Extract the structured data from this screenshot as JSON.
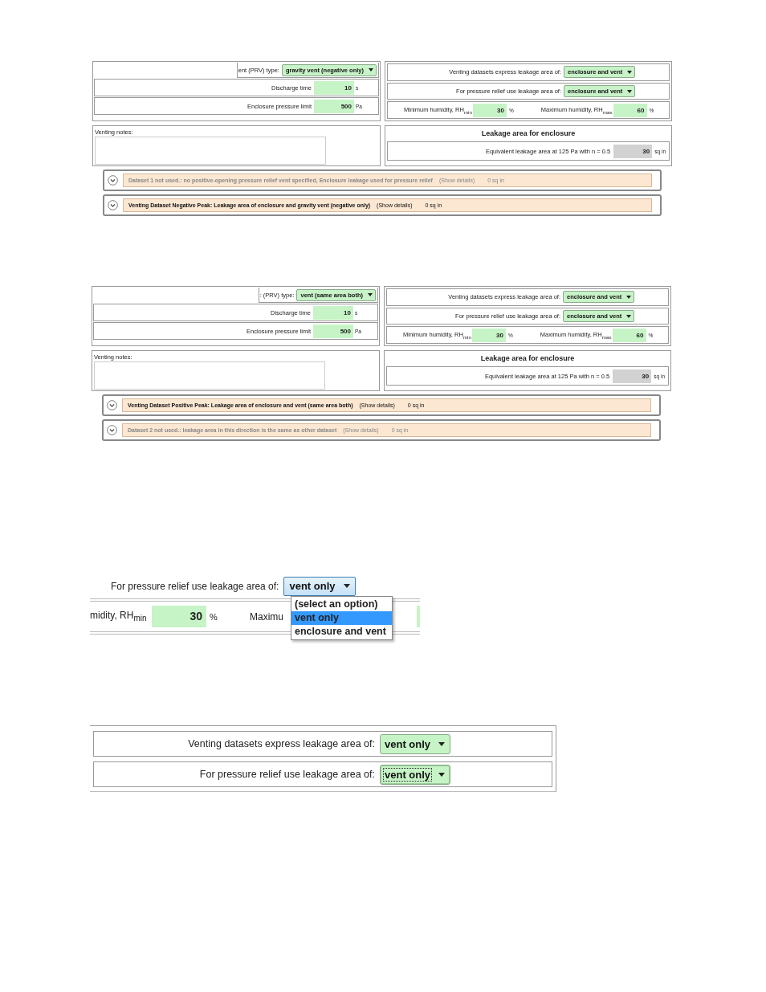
{
  "forms": [
    {
      "prv": {
        "label": "ent (PRV) type:",
        "value": "gravity vent (negative only)"
      },
      "discharge": {
        "label": "Discharge time",
        "value": "10",
        "unit": "s"
      },
      "pressure": {
        "label": "Enclosure pressure limit",
        "value": "500",
        "unit": "Pa"
      },
      "express": {
        "label": "Venting datasets express leakage area of:",
        "value": "enclosure and vent"
      },
      "relief": {
        "label": "For pressure relief use leakage area of:",
        "value": "enclosure and vent"
      },
      "hum_min": {
        "label": "Minimum humidity, RH$_{min}$",
        "value": "30",
        "unit": "%"
      },
      "hum_max": {
        "label": "Maximum humidity, RH$_{max}$",
        "value": "60",
        "unit": "%"
      },
      "notes_label": "Venting notes:",
      "leakage_title": "Leakage area for enclosure",
      "leakage": {
        "label": "Equivalent leakage area at 125 Pa with n = 0.5",
        "value": "30",
        "unit": "sq in"
      },
      "datasets": [
        {
          "title": "Dataset 1 not used.: no positive-opening pressure relief vent specified, Enclosure leakage used for pressure relief",
          "used": false,
          "details": "(Show details)",
          "area": "0 sq in"
        },
        {
          "title": "Venting Dataset Negative Peak: Leakage area of enclosure and gravity vent (negative only)",
          "used": true,
          "details": "(Show details)",
          "area": "0 sq in"
        }
      ]
    },
    {
      "prv": {
        "label": ": (PRV) type:",
        "value": "vent (same area both)"
      },
      "discharge": {
        "label": "Discharge time",
        "value": "10",
        "unit": "s"
      },
      "pressure": {
        "label": "Enclosure pressure limit",
        "value": "500",
        "unit": "Pa"
      },
      "express": {
        "label": "Venting datasets express leakage area of:",
        "value": "enclosure and vent"
      },
      "relief": {
        "label": "For pressure relief use leakage area of:",
        "value": "enclosure and vent"
      },
      "hum_min": {
        "label": "Minimum humidity, RH$_{min}$",
        "value": "30",
        "unit": "%"
      },
      "hum_max": {
        "label": "Maximum humidity, RH$_{max}$",
        "value": "60",
        "unit": "%"
      },
      "notes_label": "Venting notes:",
      "leakage_title": "Leakage area for enclosure",
      "leakage": {
        "label": "Equivalent leakage area at 125 Pa with n = 0.5",
        "value": "30",
        "unit": "sq in"
      },
      "datasets": [
        {
          "title": "Venting Dataset Positive Peak: Leakage area of enclosure and vent (same area both)",
          "used": true,
          "details": "(Show details)",
          "area": "0 sq in"
        },
        {
          "title": "Dataset 2 not used.: leakage area in this direction is the same as other dataset",
          "used": false,
          "details": "(Show details)",
          "area": "0 sq in"
        }
      ]
    }
  ],
  "dropdown_crop": {
    "label": "For pressure relief use leakage area of:",
    "value": "vent only",
    "options": [
      {
        "label": "(select an option)",
        "selected": false
      },
      {
        "label": "vent only",
        "selected": true
      },
      {
        "label": "enclosure and vent",
        "selected": false
      }
    ],
    "hum_label": "midity, RH$_{min}$",
    "hum_value": "30",
    "hum_unit": "%",
    "max_label": "Maximu"
  },
  "select_crop": {
    "rows": [
      {
        "label": "Venting datasets express leakage area of:",
        "value": "vent only",
        "focused": false
      },
      {
        "label": "For pressure relief use leakage area of:",
        "value": "vent only",
        "focused": true
      }
    ]
  }
}
